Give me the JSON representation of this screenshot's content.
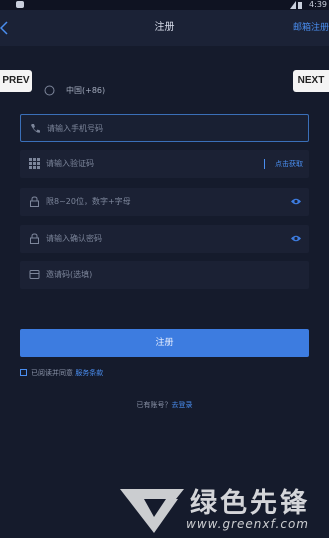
{
  "status_bar": {
    "time": "4:39"
  },
  "header": {
    "title": "注册",
    "email_register": "邮箱注册"
  },
  "overlay": {
    "prev": "PREV",
    "next": "NEXT"
  },
  "form": {
    "country": "中国(+86)",
    "phone_placeholder": "请输入手机号码",
    "code_placeholder": "请输入验证码",
    "get_code": "点击获取",
    "password_placeholder": "限8~20位，数字+字母",
    "confirm_placeholder": "请输入确认密码",
    "invite_placeholder": "邀请码(选填)"
  },
  "actions": {
    "register": "注册",
    "agree_text": "已阅读并同意",
    "terms_link": "服务条款",
    "have_account": "已有账号？",
    "login_link": "去登录"
  },
  "watermark": {
    "brand": "绿色先锋",
    "url": "www.greenxf.com"
  },
  "colors": {
    "accent": "#3d7ce0",
    "link": "#4a8ef0",
    "background": "#151b2c"
  }
}
